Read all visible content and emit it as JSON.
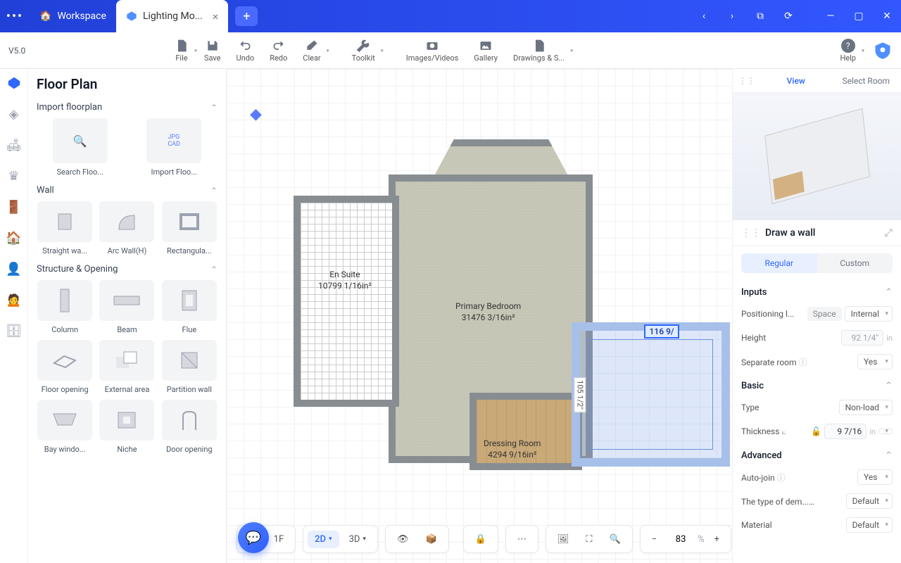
{
  "titlebar": {
    "workspace": "Workspace",
    "active_tab": "Lighting Mo...",
    "add": "+"
  },
  "toolbar": {
    "version": "V5.0",
    "file": "File",
    "save": "Save",
    "undo": "Undo",
    "redo": "Redo",
    "clear": "Clear",
    "toolkit": "Toolkit",
    "images": "Images/Videos",
    "gallery": "Gallery",
    "drawings": "Drawings & S...",
    "help": "Help"
  },
  "sidebar": {
    "title": "Floor Plan",
    "import_section": "Import floorplan",
    "import": {
      "search": "Search Floo...",
      "importfp": "Import Floo..."
    },
    "wall_section": "Wall",
    "wall": {
      "straight": "Straight wa...",
      "arc": "Arc Wall(H)",
      "rect": "Rectangula..."
    },
    "struct_section": "Structure & Opening",
    "struct": {
      "column": "Column",
      "beam": "Beam",
      "flue": "Flue",
      "flooropen": "Floor opening",
      "external": "External area",
      "partition": "Partition wall",
      "bay": "Bay windo...",
      "niche": "Niche",
      "dooropen": "Door opening"
    }
  },
  "rooms": {
    "ensuite_name": "En Suite",
    "ensuite_area": "10799 1/16in²",
    "primary_name": "Primary Bedroom",
    "primary_area": "31476 3/16in²",
    "dressing_name": "Dressing Room",
    "dressing_area": "4294 9/16in²",
    "new_width": "116 9/",
    "new_height": "105 1/2\""
  },
  "bottombar": {
    "floor": "1F",
    "mode2d": "2D",
    "mode3d": "3D",
    "zoom": "83",
    "zoom_unit": "%"
  },
  "rightpanel": {
    "tab_view": "View",
    "tab_select": "Select Room",
    "title": "Draw a wall",
    "seg_regular": "Regular",
    "seg_custom": "Custom",
    "inputs_head": "Inputs",
    "positioning_label": "Positioning l...",
    "positioning_key": "Space",
    "positioning_val": "Internal",
    "height_label": "Height",
    "height_val": "92 1/4\"",
    "height_unit": "in",
    "separate_label": "Separate room",
    "separate_val": "Yes",
    "basic_head": "Basic",
    "type_label": "Type",
    "type_val": "Non-load",
    "thickness_label": "Thickness",
    "thickness_val": "9 7/16",
    "thickness_unit": "in",
    "advanced_head": "Advanced",
    "autojoin_label": "Auto-join",
    "autojoin_val": "Yes",
    "demo_label": "The type of dem...",
    "demo_val": "Default",
    "material_label": "Material",
    "material_val": "Default"
  }
}
